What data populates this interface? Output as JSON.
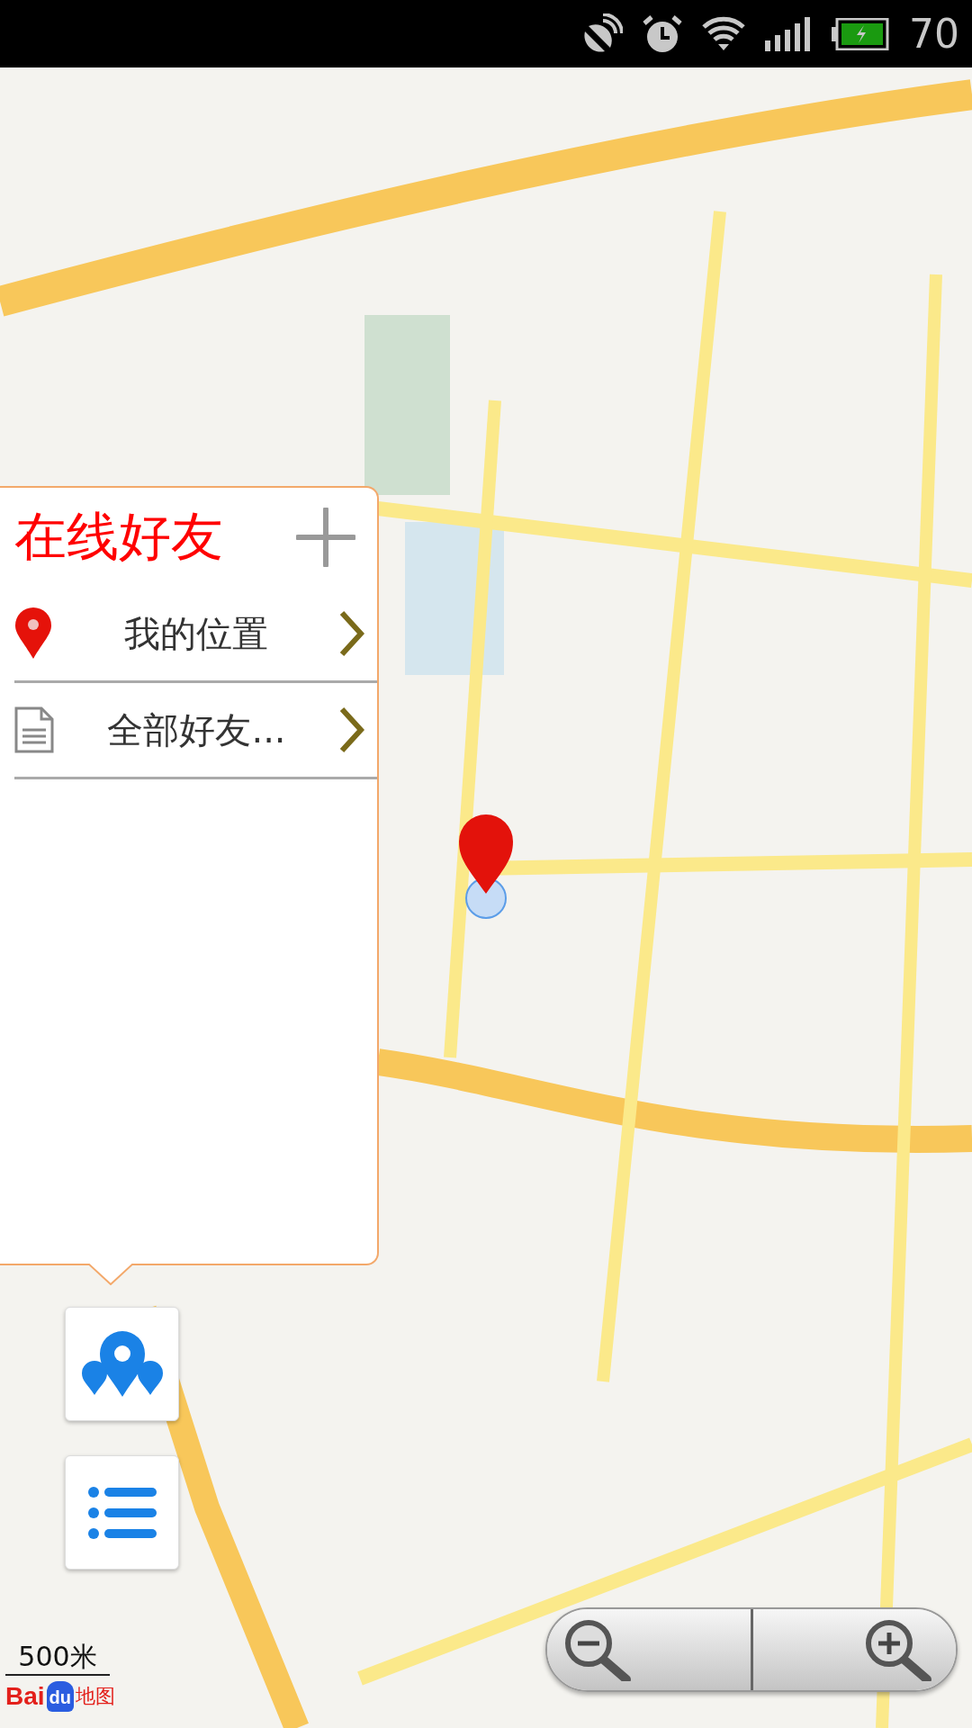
{
  "status_bar": {
    "battery": "70"
  },
  "panel": {
    "title": "在线好友",
    "items": [
      {
        "kind": "location",
        "label": "我的位置"
      },
      {
        "kind": "document",
        "label": "全部好友..."
      }
    ]
  },
  "side_buttons": [
    {
      "kind": "locations"
    },
    {
      "kind": "list"
    }
  ],
  "scale": "500米",
  "logo": {
    "brand": "Bai",
    "badge": "du",
    "product": "地图"
  }
}
